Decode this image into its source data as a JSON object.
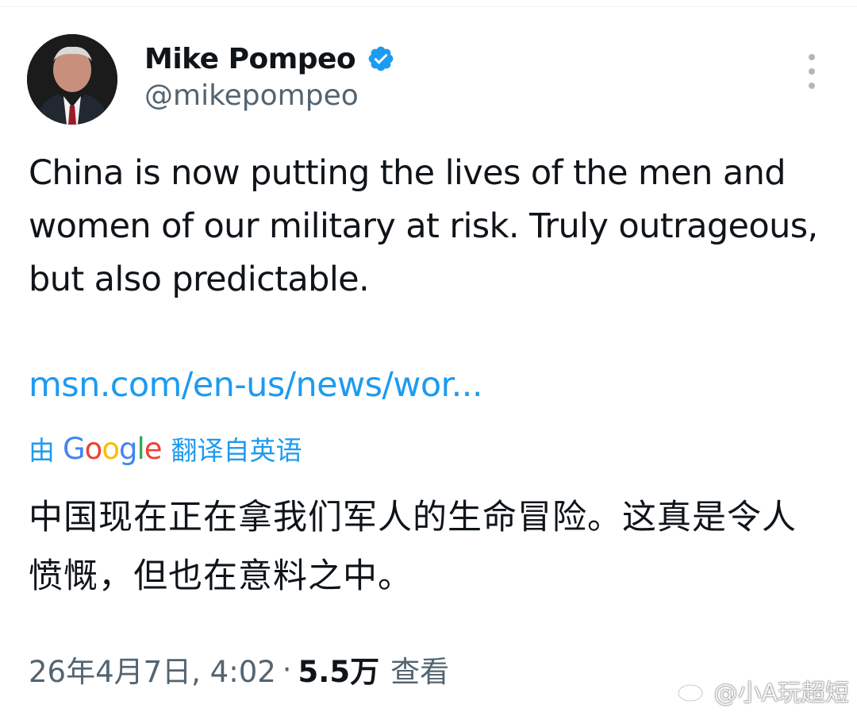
{
  "tweet": {
    "author": {
      "display_name": "Mike Pompeo",
      "handle": "@mikepompeo",
      "verified": true,
      "avatar_icon": "profile-photo"
    },
    "text": "China is now putting the lives of the men and women of our military at risk. Truly outrageous, but also predictable.",
    "link_text": "msn.com/en-us/news/wor...",
    "translation": {
      "prefix": "由",
      "provider": "Google",
      "suffix": "翻译自英语",
      "text": "中国现在正在拿我们军人的生命冒险。这真是令人愤慨，但也在意料之中。"
    },
    "meta": {
      "timestamp": "26年4月7日, 4:02",
      "separator": "·",
      "view_count": "5.5万",
      "view_label": "查看"
    },
    "more_icon": "more-vertical-icon"
  },
  "watermark": {
    "icon": "weibo-logo-icon",
    "text": "@小A玩超短"
  },
  "colors": {
    "link": "#1d9bf0",
    "secondary_text": "#536471",
    "primary_text": "#0f1419",
    "verified": "#1d9bf0"
  }
}
